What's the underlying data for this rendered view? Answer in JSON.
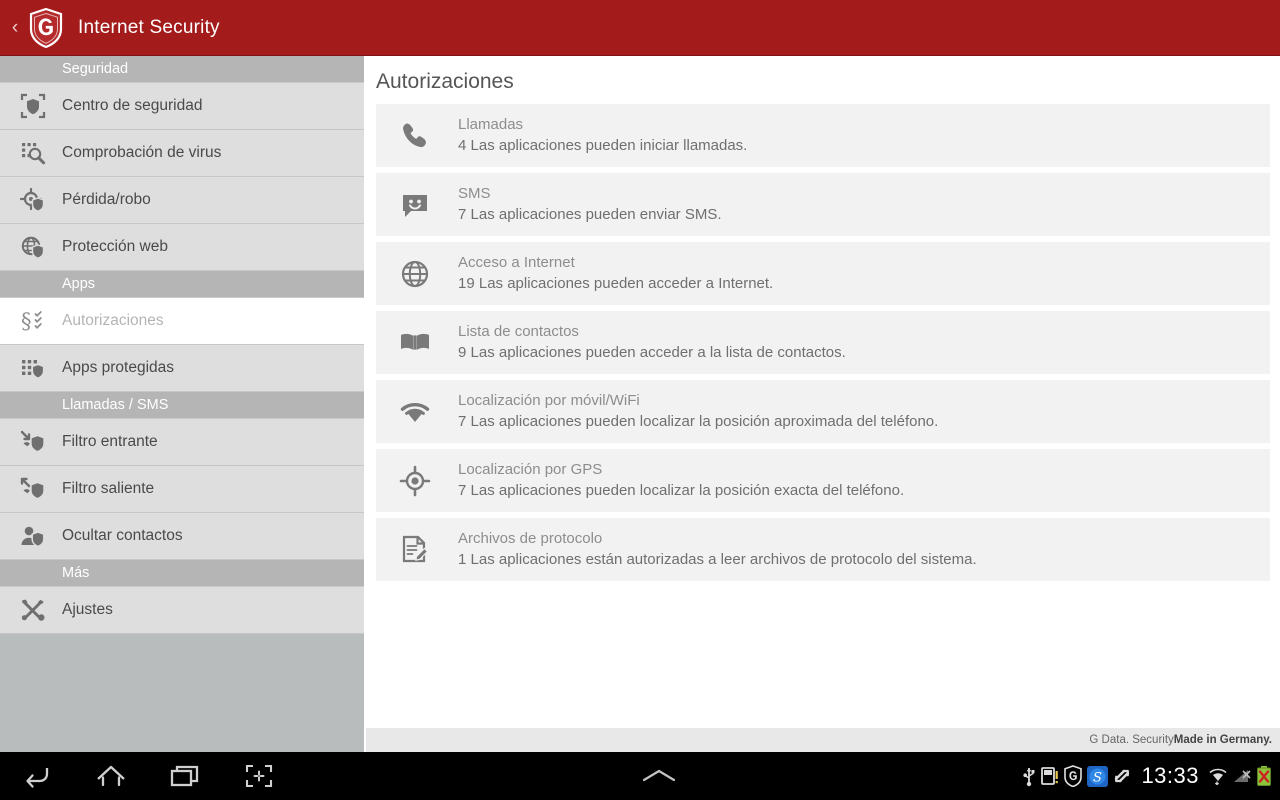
{
  "titlebar": {
    "back_label": "‹",
    "app_title": "Internet Security",
    "logo_name": "g-data-shield-logo",
    "bg_color": "#a31b1b"
  },
  "sidebar": {
    "sections": [
      {
        "header": "Seguridad",
        "items": [
          {
            "label": "Centro de seguridad",
            "icon": "shield-scan-icon",
            "selected": false
          },
          {
            "label": "Comprobación de virus",
            "icon": "virus-scan-icon",
            "selected": false
          },
          {
            "label": "Pérdida/robo",
            "icon": "target-shield-icon",
            "selected": false
          },
          {
            "label": "Protección web",
            "icon": "globe-shield-icon",
            "selected": false
          }
        ]
      },
      {
        "header": "Apps",
        "items": [
          {
            "label": "Autorizaciones",
            "icon": "permissions-icon",
            "selected": true
          },
          {
            "label": "Apps protegidas",
            "icon": "apps-shield-icon",
            "selected": false
          }
        ]
      },
      {
        "header": "Llamadas / SMS",
        "items": [
          {
            "label": "Filtro entrante",
            "icon": "incoming-filter-icon",
            "selected": false
          },
          {
            "label": "Filtro saliente",
            "icon": "outgoing-filter-icon",
            "selected": false
          },
          {
            "label": "Ocultar contactos",
            "icon": "hide-contacts-icon",
            "selected": false
          }
        ]
      },
      {
        "header": "Más",
        "items": [
          {
            "label": "Ajustes",
            "icon": "settings-tools-icon",
            "selected": false
          }
        ]
      }
    ]
  },
  "content": {
    "title": "Autorizaciones",
    "permissions": [
      {
        "icon": "phone-icon",
        "title": "Llamadas",
        "count": "4",
        "desc": "Las aplicaciones pueden iniciar llamadas."
      },
      {
        "icon": "sms-icon",
        "title": "SMS",
        "count": "7",
        "desc": "Las aplicaciones pueden enviar SMS."
      },
      {
        "icon": "globe-icon",
        "title": "Acceso a Internet",
        "count": "19",
        "desc": "Las aplicaciones pueden acceder a Internet."
      },
      {
        "icon": "contacts-book-icon",
        "title": "Lista de contactos",
        "count": "9",
        "desc": "Las aplicaciones pueden acceder a la lista de contactos."
      },
      {
        "icon": "wifi-icon",
        "title": "Localización por móvil/WiFi",
        "count": "7",
        "desc": "Las aplicaciones pueden localizar la posición aproximada del teléfono."
      },
      {
        "icon": "gps-icon",
        "title": "Localización por GPS",
        "count": "7",
        "desc": "Las aplicaciones pueden localizar la posición exacta del teléfono."
      },
      {
        "icon": "log-file-icon",
        "title": "Archivos de protocolo",
        "count": "1",
        "desc": "Las aplicaciones están autorizadas a leer archivos de protocolo del sistema."
      }
    ],
    "footer_normal": "G Data. Security ",
    "footer_bold": "Made in Germany."
  },
  "navbar": {
    "buttons": [
      {
        "name": "back-icon",
        "label": "back"
      },
      {
        "name": "home-icon",
        "label": "home"
      },
      {
        "name": "recents-icon",
        "label": "recents"
      },
      {
        "name": "screenshot-icon",
        "label": "screenshot"
      }
    ],
    "drawer_handle": "chevron-up-icon",
    "clock": "13:33",
    "tray_icons": [
      "usb-icon",
      "sd-card-warning-icon",
      "gdata-shield-icon",
      "blue-s-app-icon",
      "sync-icon",
      "wifi-icon",
      "signal-off-icon",
      "battery-error-icon"
    ]
  }
}
